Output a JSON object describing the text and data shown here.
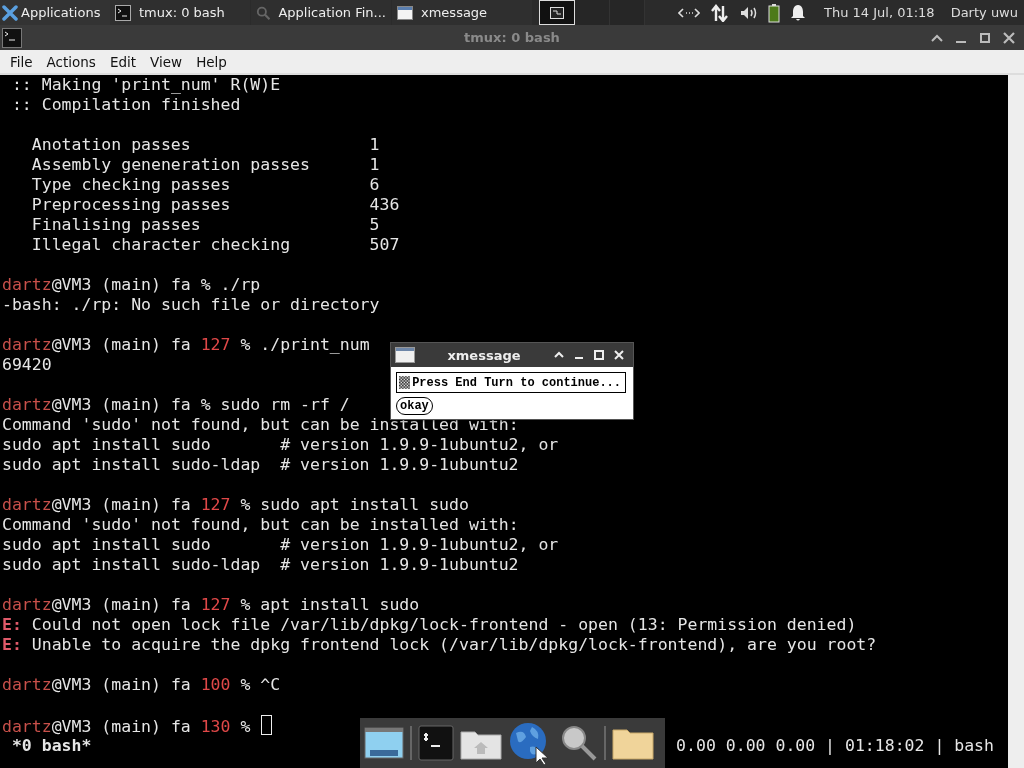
{
  "top_panel": {
    "apps_menu": "Applications",
    "tasks": [
      {
        "kind": "terminal",
        "label": "tmux: 0 bash"
      },
      {
        "kind": "search",
        "label": "Application Fin..."
      },
      {
        "kind": "window",
        "label": "xmessage"
      }
    ],
    "workspaces": [
      {
        "selected": true
      },
      {
        "selected": false
      },
      {
        "selected": false
      }
    ],
    "clock": "Thu 14 Jul, 01:18",
    "user": "Darty uwu"
  },
  "window": {
    "title": "tmux: 0 bash"
  },
  "menu": [
    "File",
    "Actions",
    "Edit",
    "View",
    "Help"
  ],
  "terminal": {
    "lines": [
      {
        "kind": "text",
        "text": " :: Making 'print_num' R(W)E"
      },
      {
        "kind": "text",
        "text": " :: Compilation finished"
      },
      {
        "kind": "blank"
      },
      {
        "kind": "stat",
        "label": "Anotation passes",
        "value": "1"
      },
      {
        "kind": "stat",
        "label": "Assembly geneneration passes",
        "value": "1"
      },
      {
        "kind": "stat",
        "label": "Type checking passes",
        "value": "6"
      },
      {
        "kind": "stat",
        "label": "Preprocessing passes",
        "value": "436"
      },
      {
        "kind": "stat",
        "label": "Finalising passes",
        "value": "5"
      },
      {
        "kind": "stat",
        "label": "Illegal character checking",
        "value": "507"
      },
      {
        "kind": "blank"
      },
      {
        "kind": "prompt",
        "user": "dartz",
        "host": "@VM3 (main) fa",
        "sign": "%",
        "command": "./rp"
      },
      {
        "kind": "text",
        "text": "-bash: ./rp: No such file or directory"
      },
      {
        "kind": "blank"
      },
      {
        "kind": "prompt",
        "user": "dartz",
        "host": "@VM3 (main) fa",
        "code": "127",
        "sign": "%",
        "command": "./print_num"
      },
      {
        "kind": "text",
        "text": "69420"
      },
      {
        "kind": "blank"
      },
      {
        "kind": "prompt",
        "user": "dartz",
        "host": "@VM3 (main) fa",
        "sign": "%",
        "command": "sudo rm -rf /"
      },
      {
        "kind": "text",
        "text": "Command 'sudo' not found, but can be installed with:"
      },
      {
        "kind": "suggest",
        "command": "sudo apt install sudo",
        "comment": "# version 1.9.9-1ubuntu2, or"
      },
      {
        "kind": "suggest",
        "command": "sudo apt install sudo-ldap",
        "comment": "# version 1.9.9-1ubuntu2"
      },
      {
        "kind": "blank"
      },
      {
        "kind": "prompt",
        "user": "dartz",
        "host": "@VM3 (main) fa",
        "code": "127",
        "sign": "%",
        "command": "sudo apt install sudo"
      },
      {
        "kind": "text",
        "text": "Command 'sudo' not found, but can be installed with:"
      },
      {
        "kind": "suggest",
        "command": "sudo apt install sudo",
        "comment": "# version 1.9.9-1ubuntu2, or"
      },
      {
        "kind": "suggest",
        "command": "sudo apt install sudo-ldap",
        "comment": "# version 1.9.9-1ubuntu2"
      },
      {
        "kind": "blank"
      },
      {
        "kind": "prompt",
        "user": "dartz",
        "host": "@VM3 (main) fa",
        "code": "127",
        "sign": "%",
        "command": "apt install sudo"
      },
      {
        "kind": "error",
        "tag": "E:",
        "text": "Could not open lock file /var/lib/dpkg/lock-frontend - open (13: Permission denied)"
      },
      {
        "kind": "error",
        "tag": "E:",
        "text": "Unable to acquire the dpkg frontend lock (/var/lib/dpkg/lock-frontend), are you root?"
      },
      {
        "kind": "blank"
      },
      {
        "kind": "prompt",
        "user": "dartz",
        "host": "@VM3 (main) fa",
        "code": "100",
        "sign": "%",
        "command": "^C"
      },
      {
        "kind": "blank"
      },
      {
        "kind": "prompt",
        "user": "dartz",
        "host": "@VM3 (main) fa",
        "code": "130",
        "sign": "%",
        "cursor": true
      }
    ],
    "status": {
      "left": " *0 bash*",
      "right": "0.00 0.00 0.00 | 01:18:02 | bash"
    }
  },
  "dialog": {
    "title": "xmessage",
    "message": "Press End Turn to continue...",
    "button": "okay"
  }
}
